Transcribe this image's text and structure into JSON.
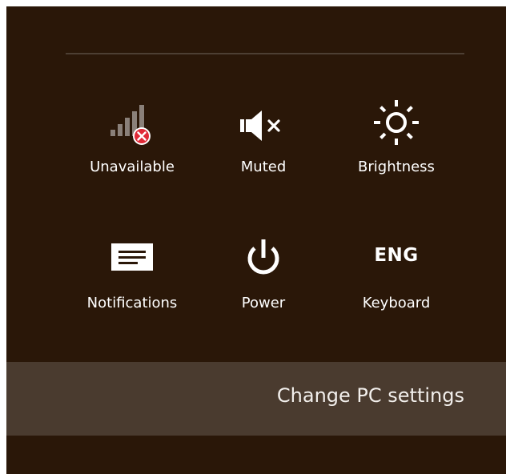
{
  "quick_settings": {
    "network": {
      "label": "Unavailable",
      "icon": "network-unavailable-icon"
    },
    "volume": {
      "label": "Muted",
      "icon": "volume-muted-icon"
    },
    "brightness": {
      "label": "Brightness",
      "icon": "brightness-icon"
    },
    "notifications": {
      "label": "Notifications",
      "icon": "notifications-icon"
    },
    "power": {
      "label": "Power",
      "icon": "power-icon"
    },
    "keyboard": {
      "label": "Keyboard",
      "icon_text": "ENG"
    }
  },
  "settings_link": {
    "label": "Change PC settings"
  },
  "colors": {
    "panel_background": "#2a1708",
    "settings_bar_background": "#4a3b2f",
    "divider": "#4d3f33",
    "error_badge": "#e02a37"
  }
}
